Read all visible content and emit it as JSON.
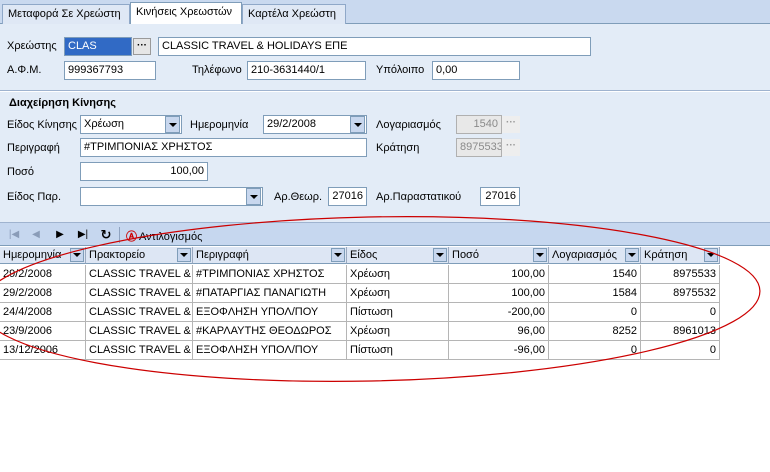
{
  "tabs": [
    "Μεταφορά Σε Χρεώστη",
    "Κινήσεις Χρεωστών",
    "Καρτέλα Χρεώστη"
  ],
  "debtor": {
    "label": "Χρεώστης",
    "code": "CLAS",
    "name": "CLASSIC TRAVEL & HOLIDAYS ΕΠΕ",
    "afm_label": "Α.Φ.Μ.",
    "afm": "999367793",
    "phone_label": "Τηλέφωνο",
    "phone": "210-3631440/1",
    "balance_label": "Υπόλοιπο",
    "balance": "0,00"
  },
  "movement": {
    "section_title": "Διαχείρηση Κίνησης",
    "type_label": "Είδος Κίνησης",
    "type_value": "Χρέωση",
    "date_label": "Ημερομηνία",
    "date_value": "29/2/2008",
    "account_label": "Λογαριασμός",
    "account_value": "1540",
    "desc_label": "Περιγραφή",
    "desc_value": "#ΤΡΙΜΠΟΝΙΑΣ ΧΡΗΣΤΟΣ",
    "reservation_label": "Κράτηση",
    "reservation_value": "8975533",
    "amount_label": "Ποσό",
    "amount_value": "100,00",
    "doc_type_label": "Είδος Παρ.",
    "doc_type_value": "",
    "theor_label": "Αρ.Θεωρ.",
    "theor_value": "27016",
    "doc_no_label": "Αρ.Παραστατικού",
    "doc_no_value": "27016"
  },
  "toolbar": {
    "recalc_label": "Αντιλογισμός"
  },
  "grid": {
    "columns": [
      "Ημερομηνία",
      "Πρακτορείο",
      "Περιγραφή",
      "Είδος",
      "Ποσό",
      "Λογαριασμός",
      "Κράτηση"
    ],
    "rows": [
      [
        "29/2/2008",
        "CLASSIC TRAVEL & I",
        "#ΤΡΙΜΠΟΝΙΑΣ ΧΡΗΣΤΟΣ",
        "Χρέωση",
        "100,00",
        "1540",
        "8975533"
      ],
      [
        "29/2/2008",
        "CLASSIC TRAVEL & I",
        "#ΠΑΤΑΡΓΙΑΣ ΠΑΝΑΓΙΩΤΗ",
        "Χρέωση",
        "100,00",
        "1584",
        "8975532"
      ],
      [
        "24/4/2008",
        "CLASSIC TRAVEL & I",
        "ΕΞΟΦΛΗΣΗ ΥΠΟΛ/ΠΟΥ",
        "Πίστωση",
        "-200,00",
        "0",
        "0"
      ],
      [
        "23/9/2006",
        "CLASSIC TRAVEL & I",
        "#ΚΑΡΛΑΥΤΗΣ ΘΕΟΔΩΡΟΣ",
        "Χρέωση",
        "96,00",
        "8252",
        "8961013"
      ],
      [
        "13/12/2006",
        "CLASSIC TRAVEL & I",
        "ΕΞΟΦΛΗΣΗ ΥΠΟΛ/ΠΟΥ",
        "Πίστωση",
        "-96,00",
        "0",
        "0"
      ]
    ]
  },
  "colors": {
    "annotation_oval": "#cc0000",
    "panel": "#e3ecf7",
    "tabbar": "#c9d9ef"
  }
}
